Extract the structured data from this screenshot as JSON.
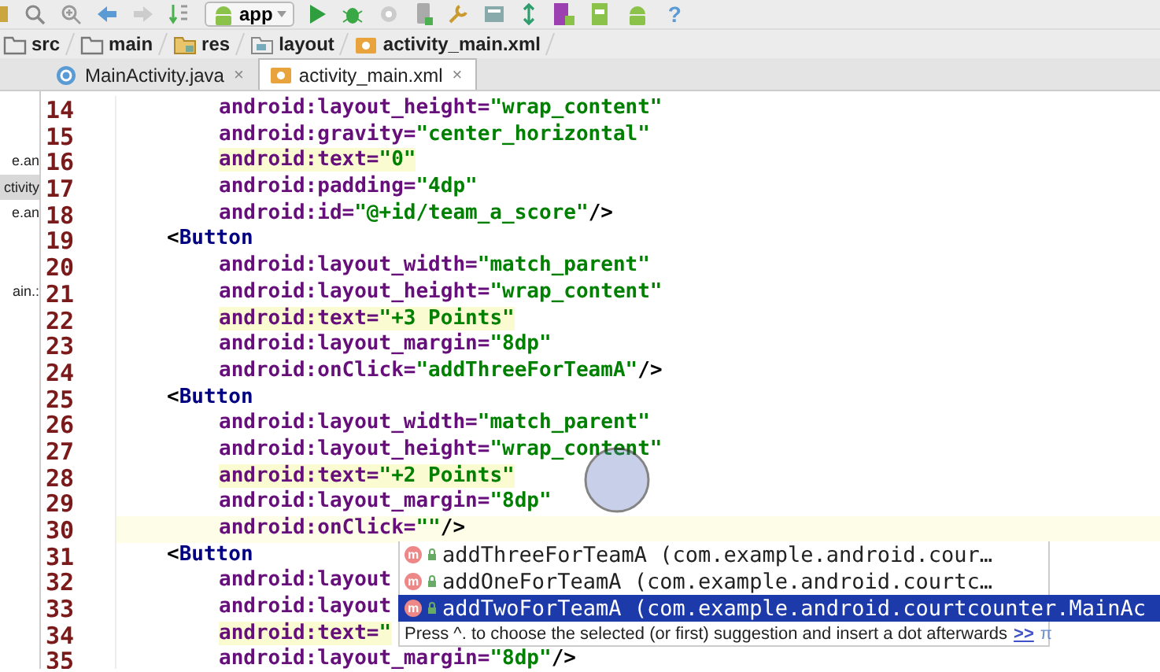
{
  "toolbar": {
    "run_config": "app",
    "help": "?"
  },
  "breadcrumbs": [
    {
      "label": "src",
      "kind": "folder"
    },
    {
      "label": "main",
      "kind": "folder"
    },
    {
      "label": "res",
      "kind": "res"
    },
    {
      "label": "layout",
      "kind": "layout"
    },
    {
      "label": "activity_main.xml",
      "kind": "xml"
    }
  ],
  "tabs": [
    {
      "label": "MainActivity.java",
      "kind": "class",
      "selected": false,
      "close": "×"
    },
    {
      "label": "activity_main.xml",
      "kind": "xml",
      "selected": true,
      "close": "×"
    }
  ],
  "project_panel": {
    "groups": [
      [
        {
          "text": "e.an",
          "selected": false
        },
        {
          "text": "ctivity",
          "selected": true
        },
        {
          "text": "e.an",
          "selected": false
        }
      ],
      [
        {
          "text": "ain.:",
          "selected": false
        }
      ]
    ]
  },
  "code_lines": [
    {
      "number": "14",
      "kind": "attribute",
      "parts": [
        {
          "kind": "attr",
          "text": "android:layout_height="
        },
        {
          "kind": "value",
          "text": "\"wrap_content\""
        }
      ],
      "highlighted": false,
      "current": false
    },
    {
      "number": "15",
      "kind": "attribute",
      "parts": [
        {
          "kind": "attr",
          "text": "android:gravity="
        },
        {
          "kind": "value",
          "text": "\"center_horizontal\""
        }
      ],
      "highlighted": false,
      "current": false
    },
    {
      "number": "16",
      "kind": "attribute",
      "parts": [
        {
          "kind": "attr",
          "text": "android:text="
        },
        {
          "kind": "value",
          "text": "\"0\""
        }
      ],
      "highlighted": true,
      "current": false
    },
    {
      "number": "17",
      "kind": "attribute",
      "parts": [
        {
          "kind": "attr",
          "text": "android:padding="
        },
        {
          "kind": "value",
          "text": "\"4dp\""
        }
      ],
      "highlighted": false,
      "current": false
    },
    {
      "number": "18",
      "kind": "attribute",
      "parts": [
        {
          "kind": "attr",
          "text": "android:id="
        },
        {
          "kind": "value",
          "text": "\"@+id/team_a_score\""
        },
        {
          "kind": "punct",
          "text": "/>"
        }
      ],
      "highlighted": false,
      "current": false
    },
    {
      "number": "19",
      "kind": "tag",
      "parts": [
        {
          "kind": "punct",
          "text": "<"
        },
        {
          "kind": "tag",
          "text": "Button"
        }
      ],
      "highlighted": false,
      "current": false
    },
    {
      "number": "20",
      "kind": "attribute",
      "parts": [
        {
          "kind": "attr",
          "text": "android:layout_width="
        },
        {
          "kind": "value",
          "text": "\"match_parent\""
        }
      ],
      "highlighted": false,
      "current": false
    },
    {
      "number": "21",
      "kind": "attribute",
      "parts": [
        {
          "kind": "attr",
          "text": "android:layout_height="
        },
        {
          "kind": "value",
          "text": "\"wrap_content\""
        }
      ],
      "highlighted": false,
      "current": false
    },
    {
      "number": "22",
      "kind": "attribute",
      "parts": [
        {
          "kind": "attr",
          "text": "android:text="
        },
        {
          "kind": "value",
          "text": "\"+3 Points\""
        }
      ],
      "highlighted": true,
      "current": false
    },
    {
      "number": "23",
      "kind": "attribute",
      "parts": [
        {
          "kind": "attr",
          "text": "android:layout_margin="
        },
        {
          "kind": "value",
          "text": "\"8dp\""
        }
      ],
      "highlighted": false,
      "current": false
    },
    {
      "number": "24",
      "kind": "attribute",
      "parts": [
        {
          "kind": "attr",
          "text": "android:onClick="
        },
        {
          "kind": "value",
          "text": "\"addThreeForTeamA\""
        },
        {
          "kind": "punct",
          "text": "/>"
        }
      ],
      "highlighted": false,
      "current": false
    },
    {
      "number": "25",
      "kind": "tag",
      "parts": [
        {
          "kind": "punct",
          "text": "<"
        },
        {
          "kind": "tag",
          "text": "Button"
        }
      ],
      "highlighted": false,
      "current": false
    },
    {
      "number": "26",
      "kind": "attribute",
      "parts": [
        {
          "kind": "attr",
          "text": "android:layout_width="
        },
        {
          "kind": "value",
          "text": "\"match_parent\""
        }
      ],
      "highlighted": false,
      "current": false
    },
    {
      "number": "27",
      "kind": "attribute",
      "parts": [
        {
          "kind": "attr",
          "text": "android:layout_height="
        },
        {
          "kind": "value",
          "text": "\"wrap_content\""
        }
      ],
      "highlighted": false,
      "current": false
    },
    {
      "number": "28",
      "kind": "attribute",
      "parts": [
        {
          "kind": "attr",
          "text": "android:text="
        },
        {
          "kind": "value",
          "text": "\"+2 Points\""
        }
      ],
      "highlighted": true,
      "current": false
    },
    {
      "number": "29",
      "kind": "attribute",
      "parts": [
        {
          "kind": "attr",
          "text": "android:layout_margin="
        },
        {
          "kind": "value",
          "text": "\"8dp\""
        }
      ],
      "highlighted": false,
      "current": false
    },
    {
      "number": "30",
      "kind": "attribute",
      "parts": [
        {
          "kind": "attr",
          "text": "android:onClick="
        },
        {
          "kind": "value",
          "text": "\"\""
        },
        {
          "kind": "punct",
          "text": "/>"
        }
      ],
      "highlighted": false,
      "current": true
    },
    {
      "number": "31",
      "kind": "tag",
      "parts": [
        {
          "kind": "punct",
          "text": "<"
        },
        {
          "kind": "tag",
          "text": "Button"
        }
      ],
      "highlighted": false,
      "current": false
    },
    {
      "number": "32",
      "kind": "attribute",
      "parts": [
        {
          "kind": "attr",
          "text": "android:layout"
        }
      ],
      "highlighted": false,
      "current": false
    },
    {
      "number": "33",
      "kind": "attribute",
      "parts": [
        {
          "kind": "attr",
          "text": "android:layout"
        }
      ],
      "highlighted": false,
      "current": false
    },
    {
      "number": "34",
      "kind": "attribute",
      "parts": [
        {
          "kind": "attr",
          "text": "android:text="
        },
        {
          "kind": "value",
          "text": "\""
        }
      ],
      "highlighted": true,
      "current": false
    },
    {
      "number": "35",
      "kind": "attribute",
      "parts": [
        {
          "kind": "attr",
          "text": "android:layout_margin="
        },
        {
          "kind": "value",
          "text": "\"8dp\""
        },
        {
          "kind": "punct",
          "text": "/>"
        }
      ],
      "highlighted": false,
      "current": false
    }
  ],
  "completion": {
    "items": [
      {
        "badge": "m",
        "name": "addThreeForTeamA",
        "detail": "(com.example.android.cour…",
        "selected": false
      },
      {
        "badge": "m",
        "name": "addOneForTeamA",
        "detail": "(com.example.android.courtc…",
        "selected": false
      },
      {
        "badge": "m",
        "name": "addTwoForTeamA",
        "detail": "(com.example.android.courtcounter.MainAc",
        "selected": true
      }
    ],
    "hint": "Press ^. to choose the selected (or first) suggestion and insert a dot afterwards",
    "hint_link": ">>",
    "pin": "π"
  }
}
